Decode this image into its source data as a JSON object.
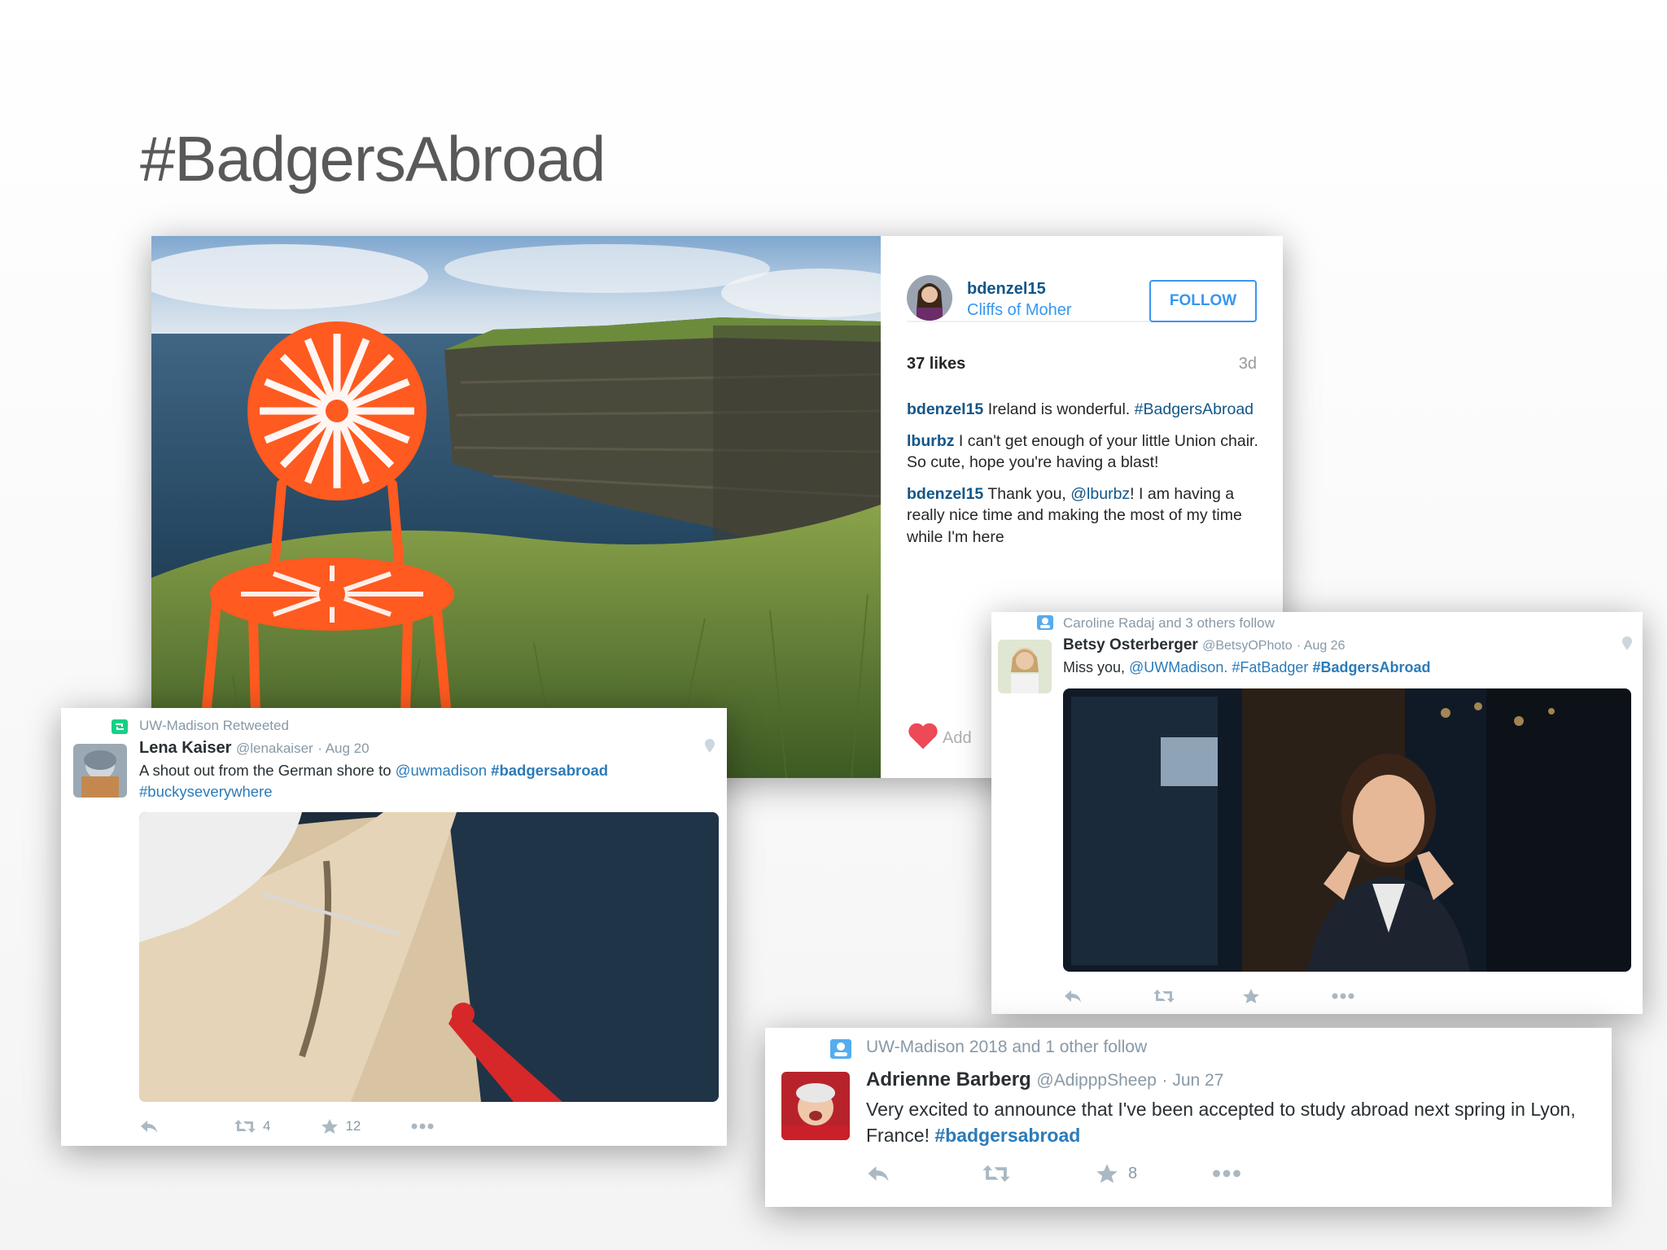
{
  "slide": {
    "title": "#BadgersAbroad"
  },
  "instagram": {
    "username": "bdenzel15",
    "location": "Cliffs of Moher",
    "follow_label": "FOLLOW",
    "likes": "37 likes",
    "age": "3d",
    "comments": [
      {
        "user": "bdenzel15",
        "text": " Ireland is wonderful. ",
        "tag": "#BadgersAbroad"
      },
      {
        "user": "lburbz",
        "text": " I can't get enough of your little Union chair. So cute, hope you're having a blast!"
      },
      {
        "user": "bdenzel15",
        "pre": " Thank you, ",
        "mention": "@lburbz",
        "post": "! I am having a really nice time and making the most of my time while I'm here"
      }
    ],
    "add_comment_placeholder": "Add"
  },
  "tweets": [
    {
      "context": "UW-Madison Retweeted",
      "name": "Lena Kaiser",
      "handle": "@lenakaiser",
      "date": "· Aug 20",
      "text_pre": "A shout out from the German shore to ",
      "mention": "@uwmadison",
      "tag1": "#badgersabroad",
      "tag2": "#buckyseverywhere",
      "retweets": "4",
      "favorites": "12"
    },
    {
      "context": "Caroline Radaj and 3 others follow",
      "name": "Betsy Osterberger",
      "handle": "@BetsyOPhoto",
      "date": "· Aug 26",
      "text_pre": "Miss you, ",
      "mention": "@UWMadison.",
      "tag1": "#FatBadger",
      "tag2": "#BadgersAbroad"
    },
    {
      "context": "UW-Madison 2018 and 1 other follow",
      "name": "Adrienne Barberg",
      "handle": "@AdipppSheep",
      "date": "· Jun 27",
      "text": "Very excited to announce that I've been accepted to study abroad next spring in Lyon, France! ",
      "tag1": "#badgersabroad",
      "favorites": "8"
    }
  ],
  "colors": {
    "instagram_link": "#125688",
    "twitter_link": "#2b7bb9",
    "heart": "#ed4956"
  },
  "icons": [
    "reply-icon",
    "retweet-icon",
    "favorite-star-icon",
    "more-icon",
    "heart-icon",
    "location-pin-icon"
  ]
}
